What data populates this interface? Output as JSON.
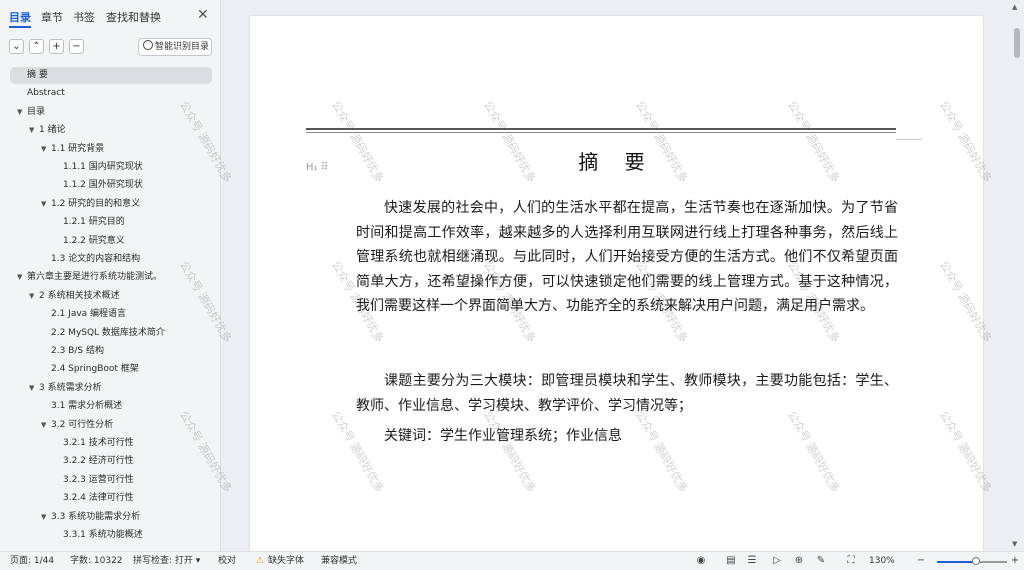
{
  "sidebar": {
    "tabs": [
      "目录",
      "章节",
      "书签",
      "查找和替换"
    ],
    "smart_toc_label": "智能识别目录",
    "toc": [
      {
        "label": "摘  要",
        "indent": 0,
        "caret": "",
        "selected": true
      },
      {
        "label": "Abstract",
        "indent": 0,
        "caret": ""
      },
      {
        "label": "目录",
        "indent": 0,
        "caret": "▼"
      },
      {
        "label": "1 绪论",
        "indent": 1,
        "caret": "▼"
      },
      {
        "label": "1.1  研究背景",
        "indent": 2,
        "caret": "▼"
      },
      {
        "label": "1.1.1 国内研究现状",
        "indent": 3,
        "caret": ""
      },
      {
        "label": "1.1.2 国外研究现状",
        "indent": 3,
        "caret": ""
      },
      {
        "label": "1.2 研究的目的和意义",
        "indent": 2,
        "caret": "▼"
      },
      {
        "label": "1.2.1 研究目的",
        "indent": 3,
        "caret": ""
      },
      {
        "label": "1.2.2  研究意义",
        "indent": 3,
        "caret": ""
      },
      {
        "label": "1.3  论文的内容和结构",
        "indent": 2,
        "caret": ""
      },
      {
        "label": "第六章主要是进行系统功能测试。",
        "indent": 0,
        "caret": "▼"
      },
      {
        "label": "2 系统相关技术概述",
        "indent": 1,
        "caret": "▼"
      },
      {
        "label": "2.1 Java 编程语言",
        "indent": 2,
        "caret": ""
      },
      {
        "label": "2.2 MySQL 数据库技术简介",
        "indent": 2,
        "caret": ""
      },
      {
        "label": "2.3 B/S 结构",
        "indent": 2,
        "caret": ""
      },
      {
        "label": "2.4 SpringBoot 框架",
        "indent": 2,
        "caret": ""
      },
      {
        "label": "3 系统需求分析",
        "indent": 1,
        "caret": "▼"
      },
      {
        "label": "3.1 需求分析概述",
        "indent": 2,
        "caret": ""
      },
      {
        "label": "3.2 可行性分析",
        "indent": 2,
        "caret": "▼"
      },
      {
        "label": "3.2.1 技术可行性",
        "indent": 3,
        "caret": ""
      },
      {
        "label": "3.2.2 经济可行性",
        "indent": 3,
        "caret": ""
      },
      {
        "label": "3.2.3 运营可行性",
        "indent": 3,
        "caret": ""
      },
      {
        "label": "3.2.4 法律可行性",
        "indent": 3,
        "caret": ""
      },
      {
        "label": "3.3 系统功能需求分析",
        "indent": 2,
        "caret": "▼"
      },
      {
        "label": "3.3.1 系统功能概述",
        "indent": 3,
        "caret": ""
      }
    ]
  },
  "document": {
    "title": "摘 要",
    "heading_marker": "H₁ ⠿",
    "paragraph1": "快速发展的社会中，人们的生活水平都在提高，生活节奏也在逐渐加快。为了节省时间和提高工作效率，越来越多的人选择利用互联网进行线上打理各种事务，然后线上管理系统也就相继涌现。与此同时，人们开始接受方便的生活方式。他们不仅希望页面简单大方，还希望操作方便，可以快速锁定他们需要的线上管理方式。基于这种情况，我们需要这样一个界面简单大方、功能齐全的系统来解决用户问题，满足用户需求。",
    "paragraph2": "课题主要分为三大模块：即管理员模块和学生、教师模块，主要功能包括：学生、教师、作业信息、学习模块、教学评价、学习情况等；",
    "paragraph3": "关键词：学生作业管理系统；作业信息",
    "watermark": "公众号 源码好优多"
  },
  "status": {
    "page": "页面: 1/44",
    "words": "字数: 10322",
    "spell": "拼写检查: 打开 ▾",
    "proof": "校对",
    "missing_font": "缺失字体",
    "compat": "兼容模式",
    "zoom": "130%",
    "zoom_fraction": 0.55
  }
}
